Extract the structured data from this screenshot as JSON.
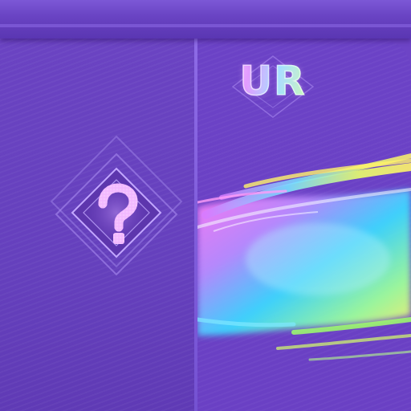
{
  "screen": {
    "background": "#6d44c6",
    "accent": "#8a68e2"
  },
  "cards": {
    "left": {
      "state": "hidden",
      "icon": "question-mark-icon",
      "glyph": "?",
      "glyph_color": "#f2b8ff"
    },
    "right": {
      "state": "revealed",
      "rarity": "UR",
      "swash_colors": [
        "#ff7cf5",
        "#7fe8ff",
        "#3bd8ff",
        "#d6ff6a",
        "#fff36a"
      ]
    }
  }
}
